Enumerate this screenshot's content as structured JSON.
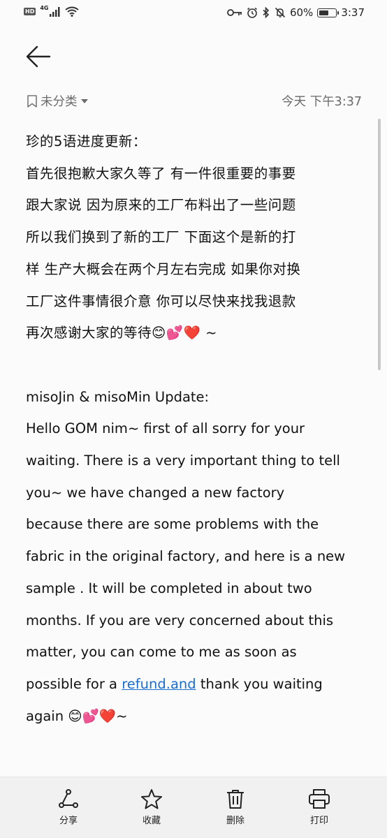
{
  "status_bar": {
    "network_badge": "HD",
    "network_type": "4G",
    "battery": "60%",
    "battery_level": 0.6,
    "time": "3:37",
    "icons": [
      "key-icon",
      "alarm-icon",
      "bluetooth-icon",
      "mute-icon"
    ]
  },
  "header": {
    "back_icon": "arrow-left-icon"
  },
  "meta": {
    "category": "未分类",
    "date": "今天 下午3:37"
  },
  "note": {
    "zh_lines": [
      "珍的5语进度更新：",
      "首先很抱歉大家久等了 有一件很重要的事要",
      "跟大家说  因为原来的工厂布料出了一些问题",
      "所以我们换到了新的工厂 下面这个是新的打",
      "样 生产大概会在两个月左右完成 如果你对换",
      "工厂这件事情很介意 你可以尽快来找我退款",
      "再次感谢大家的等待😊💕❤️ ~"
    ],
    "en_lines": [
      "misoJin & misoMin Update:",
      "Hello GOM nim~ first of all  sorry for your",
      "waiting. There is a very important thing to tell",
      "you~  we have changed  a new factory",
      "because there are some problems with the",
      "fabric in the original factory,  and here is a new",
      "sample . It will be completed in about two",
      "months. If you are very concerned about this",
      "matter, you can come to me as soon as"
    ],
    "line_pre_link": "possible for a ",
    "link_text": "refund.and",
    "line_post_link": " thank you  waiting",
    "last_line": "again 😊💕❤️~"
  },
  "toolbar": {
    "share": "分享",
    "favorite": "收藏",
    "delete": "删除",
    "print": "打印"
  }
}
